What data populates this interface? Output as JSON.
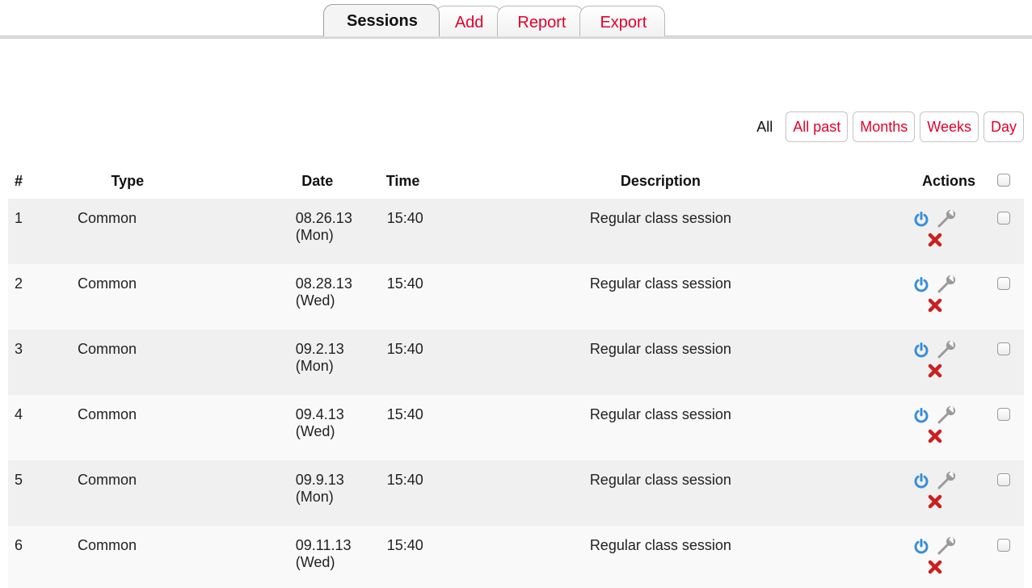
{
  "tabs": [
    {
      "label": "Sessions",
      "active": true
    },
    {
      "label": "Add",
      "active": false
    },
    {
      "label": "Report",
      "active": false
    },
    {
      "label": "Export",
      "active": false
    }
  ],
  "filters": {
    "current": "All",
    "buttons": [
      "All past",
      "Months",
      "Weeks",
      "Day"
    ]
  },
  "table": {
    "headers": {
      "num": "#",
      "type": "Type",
      "date": "Date",
      "time": "Time",
      "description": "Description",
      "actions": "Actions"
    },
    "rows": [
      {
        "num": "1",
        "type": "Common",
        "date": "08.26.13 (Mon)",
        "time": "15:40",
        "description": "Regular class session"
      },
      {
        "num": "2",
        "type": "Common",
        "date": "08.28.13 (Wed)",
        "time": "15:40",
        "description": "Regular class session"
      },
      {
        "num": "3",
        "type": "Common",
        "date": "09.2.13 (Mon)",
        "time": "15:40",
        "description": "Regular class session"
      },
      {
        "num": "4",
        "type": "Common",
        "date": "09.4.13 (Wed)",
        "time": "15:40",
        "description": "Regular class session"
      },
      {
        "num": "5",
        "type": "Common",
        "date": "09.9.13 (Mon)",
        "time": "15:40",
        "description": "Regular class session"
      },
      {
        "num": "6",
        "type": "Common",
        "date": "09.11.13 (Wed)",
        "time": "15:40",
        "description": "Regular class session"
      }
    ]
  },
  "icons": {
    "take_attendance": "power-icon",
    "edit": "wrench-icon",
    "delete": "delete-x-icon"
  },
  "colors": {
    "link": "#e4002b",
    "power_icon": "#3a8fd8",
    "delete_icon": "#cc1f1f",
    "row_odd": "#f0f0f0",
    "row_even": "#f9f9f9"
  }
}
